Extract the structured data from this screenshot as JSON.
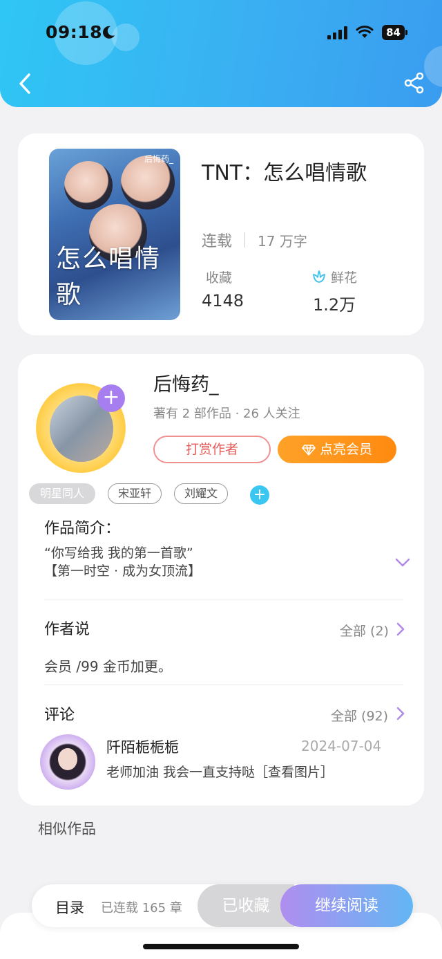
{
  "status_bar": {
    "time": "09:18",
    "battery": "84"
  },
  "nav": {
    "back_icon": "chevron-left-icon",
    "share_icon": "share-icon"
  },
  "book": {
    "title": "TNT：怎么唱情歌",
    "status": "连载",
    "word_count": "17 万字",
    "favorites_label": "收藏",
    "favorites_value": "4148",
    "flowers_label": "鲜花",
    "flowers_value": "1.2万",
    "cover": {
      "title": "怎么唱情歌",
      "author": "后悔药_"
    }
  },
  "author": {
    "name": "后悔药_",
    "meta": "著有 2 部作品 · 26 人关注",
    "tip_button": "打赏作者",
    "vip_button": "点亮会员",
    "follow_symbol": "+"
  },
  "tags": [
    "明星同人",
    "宋亚轩",
    "刘耀文"
  ],
  "tag_add_symbol": "+",
  "intro": {
    "label": "作品简介：",
    "line1": "“你写给我 我的第一首歌”",
    "line2": "【第一时空 · 成为女顶流】"
  },
  "author_says": {
    "label": "作者说",
    "all_link": "全部 (2)",
    "text": "会员 /99 金币加更。"
  },
  "comments": {
    "label": "评论",
    "all_link": "全部 (92)",
    "items": [
      {
        "user": "阡陌栀栀栀",
        "date": "2024-07-04",
        "text": "老师加油 我会一直支持哒［查看图片］"
      }
    ]
  },
  "similar": {
    "label": "相似作品"
  },
  "bottom_bar": {
    "toc_label": "目录",
    "toc_count": "已连载 165 章",
    "collected": "已收藏",
    "continue": "继续阅读"
  },
  "colors": {
    "header_gradient_start": "#2fc6f5",
    "header_gradient_end": "#3a9cf0",
    "vip_orange": "#ff8a10",
    "accent_purple": "#a77ef0",
    "tip_red": "#e55858"
  }
}
